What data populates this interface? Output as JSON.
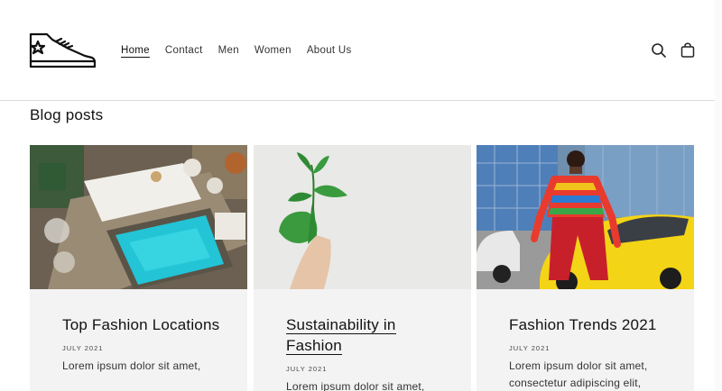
{
  "header": {
    "logo_icon": "sneaker-logo-icon",
    "nav": [
      {
        "label": "Home",
        "active": true
      },
      {
        "label": "Contact",
        "active": false
      },
      {
        "label": "Men",
        "active": false
      },
      {
        "label": "Women",
        "active": false
      },
      {
        "label": "About Us",
        "active": false
      }
    ],
    "search_icon": "search-icon",
    "cart_icon": "shopping-bag-icon"
  },
  "section": {
    "title": "Blog posts"
  },
  "posts": [
    {
      "title": "Top Fashion Locations",
      "date": "JULY 2021",
      "excerpt": "Lorem ipsum dolor sit amet,",
      "image": "pool-aerial-photo"
    },
    {
      "title": "Sustainability in Fashion",
      "date": "JULY 2021",
      "excerpt": "Lorem ipsum dolor sit amet,",
      "image": "hand-holding-plant-photo"
    },
    {
      "title": "Fashion Trends 2021",
      "date": "JULY 2021",
      "excerpt": "Lorem ipsum dolor sit amet, consectetur adipiscing elit,",
      "image": "woman-yellow-car-photo"
    }
  ]
}
